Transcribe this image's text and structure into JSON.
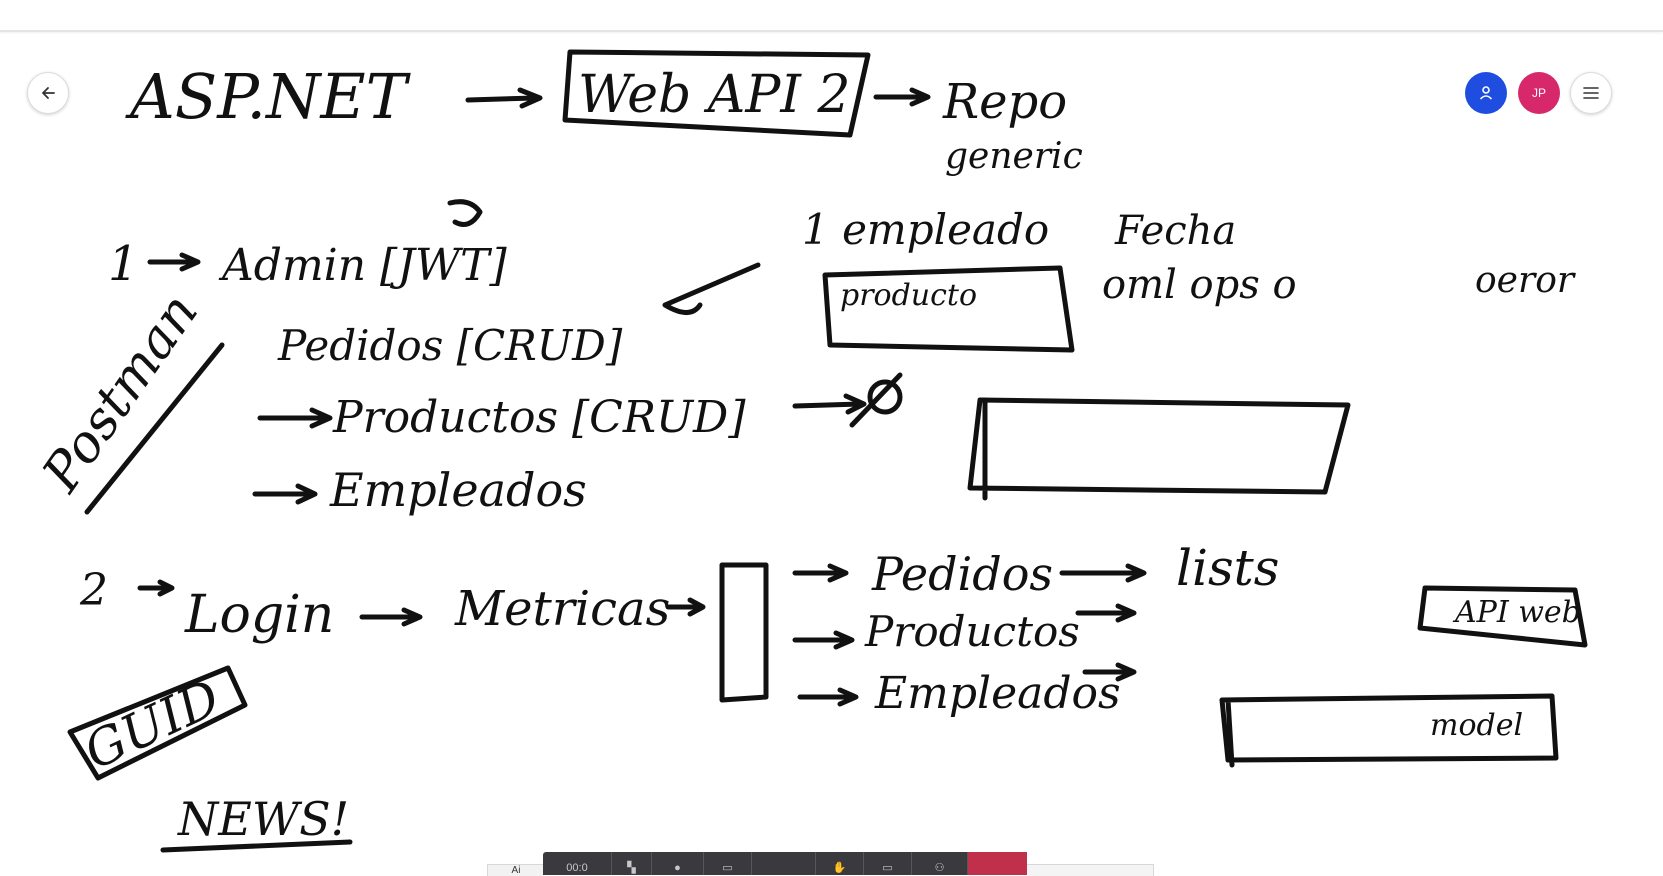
{
  "board": {
    "ink_color": "#111111",
    "background": "#ffffff",
    "notes": {
      "aspnet": "ASP.NET",
      "webapi": "Web API 2",
      "repo": "Repo",
      "generic": "generic",
      "step1": "1",
      "admin": "Admin [JWT]",
      "pedidos_crud": "Pedidos [CRUD]",
      "productos_crud": "Productos [CRUD]",
      "empleados": "Empleados",
      "postman": "Postman",
      "empleado": "1 empleado",
      "producto": "producto",
      "fecha": "Fecha",
      "oml": "oml ops o",
      "oeror": "oeror",
      "step2": "2",
      "login": "Login",
      "metricas": "Metricas",
      "pedidos2": "Pedidos",
      "productos2": "Productos",
      "empleados2": "Empleados",
      "lists": "lists",
      "apiweb": "API web",
      "modelo": "model",
      "guid": "GUID",
      "news": "NEWS!"
    }
  },
  "controls": {
    "avatar_initials": "JP",
    "user_color": "#1e4de0",
    "avatar_color": "#d6286b"
  },
  "toolbar": {
    "left_label": "Ai",
    "time_label": "00:0",
    "end_color": "#c0304a"
  }
}
